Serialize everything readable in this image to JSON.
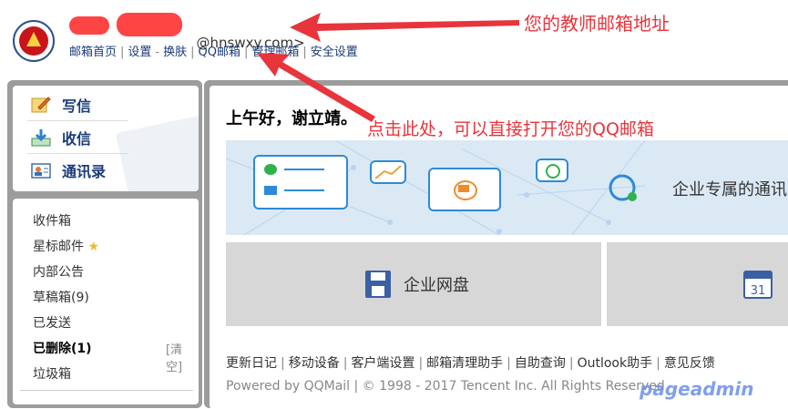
{
  "header": {
    "email_suffix": "@hnswxy.com>",
    "nav": [
      "邮箱首页",
      "设置",
      "换肤",
      "QQ邮箱",
      "管理邮箱",
      "安全设置"
    ]
  },
  "annotations": {
    "email_hint": "您的教师邮箱地址",
    "qq_hint": "点击此处，可以直接打开您的QQ邮箱"
  },
  "actions": [
    {
      "label": "写信",
      "icon": "compose-icon"
    },
    {
      "label": "收信",
      "icon": "inbox-download-icon"
    },
    {
      "label": "通讯录",
      "icon": "contacts-icon"
    }
  ],
  "folders": {
    "inbox": "收件箱",
    "starred": "星标邮件",
    "notice": "内部公告",
    "drafts": "草稿箱(9)",
    "sent": "已发送",
    "deleted": "已删除(1)",
    "clear": "[清空]",
    "spam": "垃圾箱"
  },
  "main": {
    "greeting": "上午好，谢立靖。",
    "banner_text": "企业专属的通讯",
    "disk_label": "企业网盘",
    "calendar_day": "31"
  },
  "footer": {
    "links": [
      "更新日记",
      "移动设备",
      "客户端设置",
      "邮箱清理助手",
      "自助查询",
      "Outlook助手",
      "意见反馈"
    ],
    "copyright": "Powered by QQMail  |  © 1998 - 2017 Tencent Inc. All Rights Reserved"
  },
  "watermark": "pageadmin",
  "colors": {
    "annotation": "#e8343b",
    "link": "#1a3b7a",
    "arrow": "#e8343b"
  }
}
